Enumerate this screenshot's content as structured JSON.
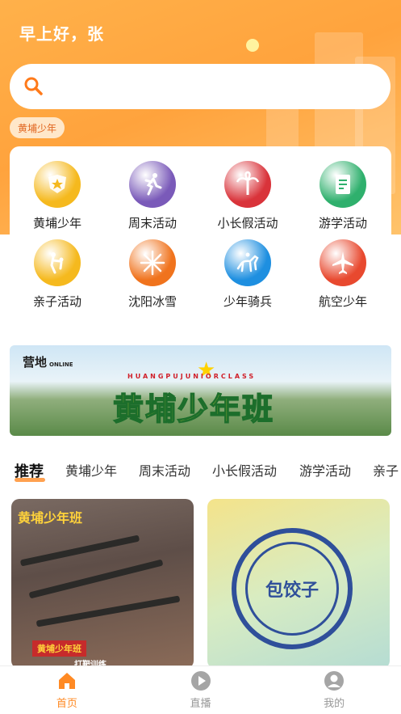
{
  "header": {
    "greeting": "早上好，张"
  },
  "search": {
    "placeholder": ""
  },
  "tag_chip": "黄埔少年",
  "menu": [
    {
      "label": "黄埔少年",
      "icon": "badge-icon",
      "color": "#f5b91e"
    },
    {
      "label": "周末活动",
      "icon": "running-person-icon",
      "color": "#7a5ab9"
    },
    {
      "label": "小长假活动",
      "icon": "palm-tree-icon",
      "color": "#d9333a"
    },
    {
      "label": "游学活动",
      "icon": "certificate-icon",
      "color": "#2fb06d"
    },
    {
      "label": "亲子活动",
      "icon": "parent-child-icon",
      "color": "#f5b91e"
    },
    {
      "label": "沈阳冰雪",
      "icon": "snowflake-icon",
      "color": "#f0731d"
    },
    {
      "label": "少年骑兵",
      "icon": "horse-rider-icon",
      "color": "#1e8fe0"
    },
    {
      "label": "航空少年",
      "icon": "airplane-icon",
      "color": "#e8492f"
    }
  ],
  "banner": {
    "logo": "营地",
    "logo_sub": "ONLINE",
    "subtitle": "HUANGPUJUNIORCLASS",
    "title": "黄埔少年班"
  },
  "tabs": [
    "推荐",
    "黄埔少年",
    "周末活动",
    "小长假活动",
    "游学活动",
    "亲子"
  ],
  "cards": [
    {
      "label_top": "黄埔少年班",
      "label_mid": "黄埔少年班",
      "label_bottom": "打靶训练"
    },
    {
      "label": "包饺子"
    }
  ],
  "bottom_nav": [
    {
      "label": "首页",
      "icon": "home-icon",
      "active": true
    },
    {
      "label": "直播",
      "icon": "play-icon",
      "active": false
    },
    {
      "label": "我的",
      "icon": "user-icon",
      "active": false
    }
  ],
  "colors": {
    "accent": "#ff8a24",
    "header": "#ffa33d"
  }
}
